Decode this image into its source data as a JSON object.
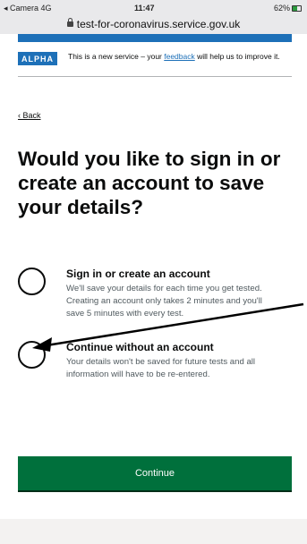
{
  "status_bar": {
    "carrier": "◂ Camera",
    "signal": "4G",
    "time": "11:47",
    "battery": "62%"
  },
  "browser": {
    "url": "test-for-coronavirus.service.gov.uk"
  },
  "phase_banner": {
    "tag": "ALPHA",
    "text_before": "This is a new service – your ",
    "link": "feedback",
    "text_after": " will help us to improve it."
  },
  "back_link": "Back",
  "heading": "Would you like to sign in or create an account to save your details?",
  "options": [
    {
      "label": "Sign in or create an account",
      "hint": "We'll save your details for each time you get tested. Creating an account only takes 2 minutes and you'll save 5 minutes with every test.",
      "checked": false
    },
    {
      "label": "Continue without an account",
      "hint": "Your details won't be saved for future tests and all information will have to be re-entered.",
      "checked": false
    }
  ],
  "continue_button": "Continue"
}
